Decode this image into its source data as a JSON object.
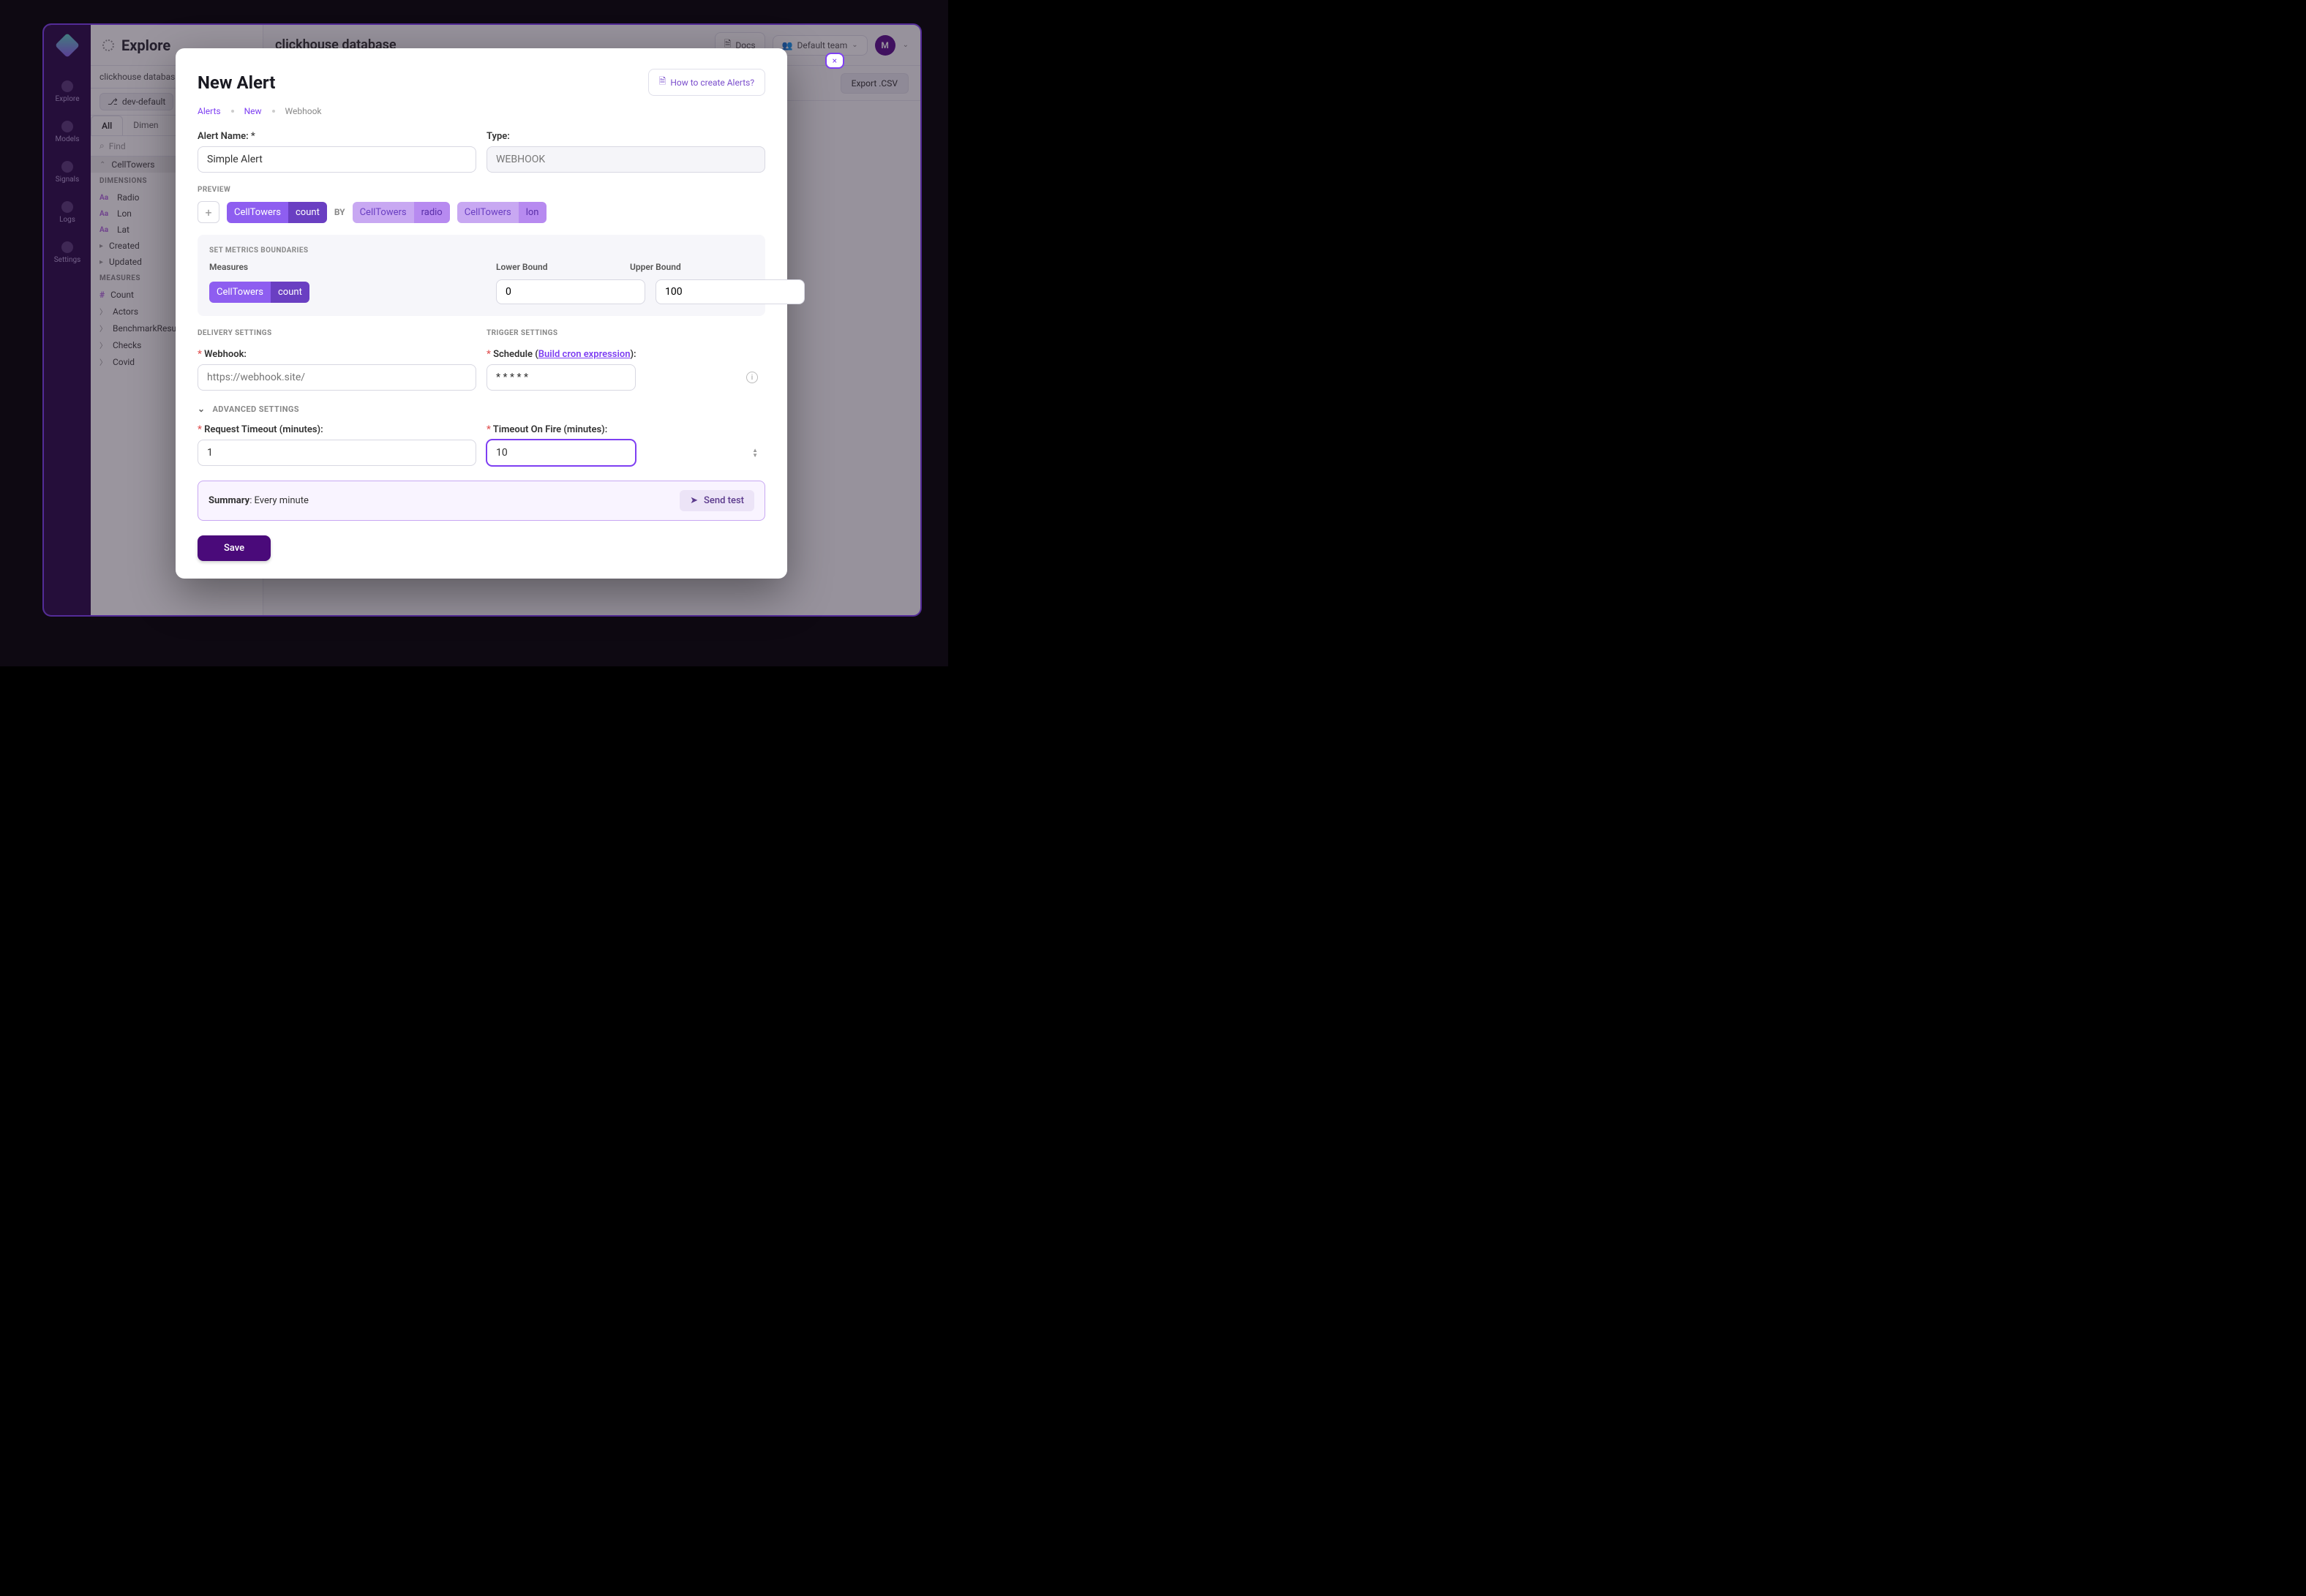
{
  "rail": {
    "items": [
      "Explore",
      "Models",
      "Signals",
      "Logs",
      "Settings"
    ]
  },
  "side": {
    "title": "Explore",
    "crumb": "clickhouse databas",
    "branch": "dev-default",
    "tabs": {
      "all": "All",
      "dim": "Dimen"
    },
    "find_placeholder": "Find",
    "cube": "CellTowers",
    "dimensions_label": "DIMENSIONS",
    "dims": [
      "Radio",
      "Lon",
      "Lat"
    ],
    "created": "Created",
    "updated": "Updated",
    "measures_label": "MEASURES",
    "count": "Count",
    "others": [
      "Actors",
      "BenchmarkResult",
      "Checks",
      "Covid"
    ]
  },
  "main": {
    "title": "clickhouse database",
    "docs": "Docs",
    "team": "Default team",
    "avatar": "M",
    "export": "Export .CSV",
    "close": "×"
  },
  "modal": {
    "title": "New Alert",
    "howto": "How to create Alerts?",
    "crumbs": [
      "Alerts",
      "New",
      "Webhook"
    ],
    "name_label": "Alert Name: *",
    "name_value": "Simple Alert",
    "type_label": "Type:",
    "type_value": "WEBHOOK",
    "preview": "PREVIEW",
    "by": "BY",
    "pills": [
      {
        "a": "CellTowers",
        "b": "count",
        "variant": "solid"
      },
      {
        "a": "CellTowers",
        "b": "radio",
        "variant": "light"
      },
      {
        "a": "CellTowers",
        "b": "lon",
        "variant": "light"
      }
    ],
    "metrics": {
      "header": "SET METRICS BOUNDARIES",
      "measures": "Measures",
      "lower": "Lower Bound",
      "upper": "Upper Bound",
      "pill": {
        "a": "CellTowers",
        "b": "count"
      },
      "lower_val": "0",
      "upper_val": "100"
    },
    "delivery": "DELIVERY SETTINGS",
    "trigger": "TRIGGER SETTINGS",
    "webhook_label": "Webhook:",
    "webhook_placeholder": "https://webhook.site/",
    "schedule_label": "Schedule (",
    "schedule_link": "Build cron expression",
    "schedule_tail": "):",
    "schedule_value": "* * * * *",
    "advanced": "ADVANCED SETTINGS",
    "req_timeout_label": "Request Timeout (minutes):",
    "req_timeout_value": "1",
    "fire_timeout_label": "Timeout On Fire (minutes):",
    "fire_timeout_value": "10",
    "summary_label": "Summary",
    "summary_value": ": Every minute",
    "sendtest": "Send test",
    "save": "Save"
  }
}
